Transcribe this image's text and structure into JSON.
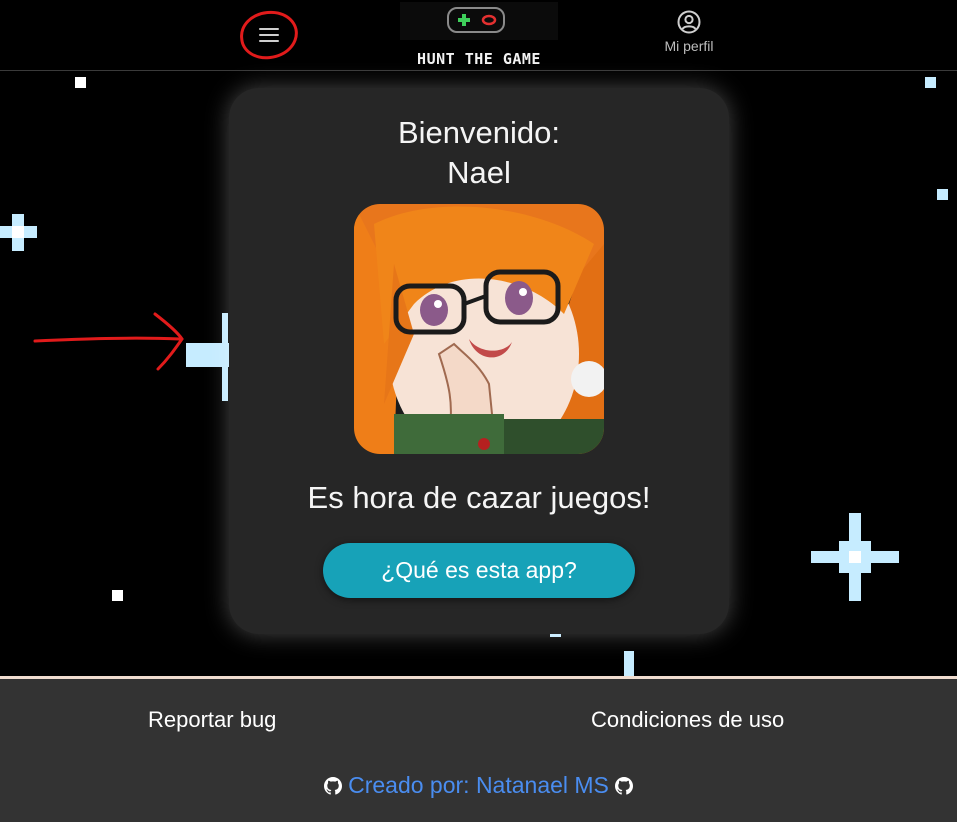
{
  "header": {
    "logo_text": "HUNT THE GAME",
    "profile_label": "Mi perfil",
    "menu_icon": "hamburger-menu-icon",
    "profile_icon": "user-circle-icon"
  },
  "card": {
    "welcome_label": "Bienvenido:",
    "user_name": "Nael",
    "tagline": "Es hora de cazar juegos!",
    "about_button": "¿Qué es esta app?"
  },
  "footer": {
    "report_bug": "Reportar bug",
    "terms": "Condiciones de uso",
    "credit": "Creado por: Natanael MS",
    "credit_icon": "github-icon"
  },
  "colors": {
    "background": "#000000",
    "card": "#262626",
    "button": "#17a2b8",
    "footer": "#333333",
    "link": "#4a8df0",
    "annotation": "#e11b1b",
    "star": "#c6ecff"
  }
}
